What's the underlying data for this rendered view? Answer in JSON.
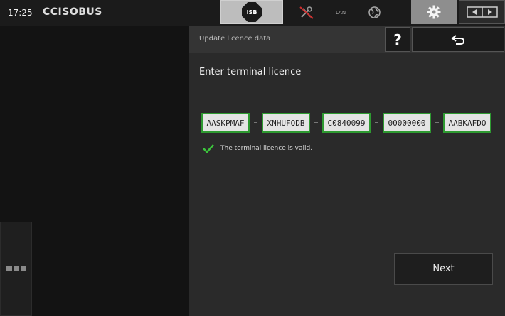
{
  "topbar": {
    "time": "17:25",
    "logo": "CCISOBUS",
    "isb_label": "ISB",
    "lan_label": "LAN"
  },
  "header": {
    "title": "Update licence data",
    "help_label": "?"
  },
  "content": {
    "section_title": "Enter terminal licence",
    "licence_fields": [
      "AASKPMAF",
      "XNHUFQDB",
      "C0840099",
      "00000000",
      "AABKAFDO"
    ],
    "valid_message": "The terminal licence is valid.",
    "next_label": "Next"
  },
  "colors": {
    "valid_green": "#2e9a31",
    "checkmark_green": "#3cc43c"
  }
}
